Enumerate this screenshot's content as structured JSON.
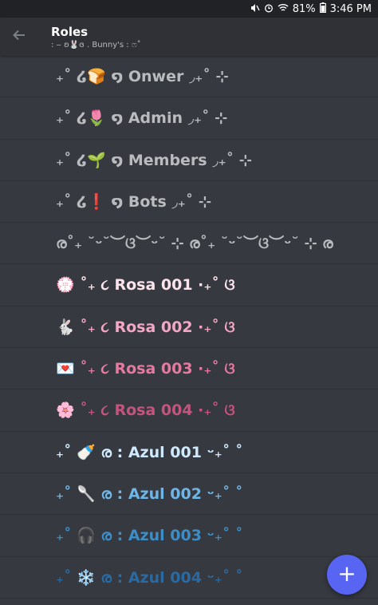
{
  "status_bar": {
    "mute_icon": "mute-icon",
    "alarm_icon": "alarm-icon",
    "wifi_icon": "wifi-icon",
    "battery_percent": "81%",
    "battery_icon": "battery-icon",
    "time": "3:46 PM"
  },
  "app_bar": {
    "back_icon": "arrow-left-icon",
    "title": "Roles",
    "subtitle": ": ‒ ʚ🐰ɞ . Bunny's : ෆ˚"
  },
  "roles": [
    {
      "name": "₊˚ ໒🍞 ໑ Onwer ◞₊˚ ⊹",
      "color": "#b9bbbe"
    },
    {
      "name": "₊˚ ໒🌷 ໑ Admin ◞₊˚ ⊹",
      "color": "#b9bbbe"
    },
    {
      "name": "₊˚ ໒🌱 ໑ Members ◞₊˚ ⊹",
      "color": "#b9bbbe"
    },
    {
      "name": "₊˚ ໒❗ ໑ Bots ◞₊˚ ⊹",
      "color": "#b9bbbe"
    },
    {
      "name": "ര˚₊ ˘ᵕ˘︶ଓ︶ᵕ˘ ⊹ ര˚₊ ˘ᵕ˘︶ଓ︶ᵕ˘ ⊹ ര",
      "color": "#b9bbbe"
    },
    {
      "name": "💮 ˚₊ ૮ Rosa 001 ·₊˚ ଓ",
      "color": "#fce4ec"
    },
    {
      "name": "🐇 ˚₊ ૮ Rosa 002 ·₊˚ ଓ",
      "color": "#f4a7c5"
    },
    {
      "name": "💌 ˚₊ ૮ Rosa 003 ·₊˚ ଓ",
      "color": "#e57aa0"
    },
    {
      "name": "🌸 ˚₊ ૮ Rosa 004 ·₊˚ ଓ",
      "color": "#c4547e"
    },
    {
      "name": "₊˚ 🍼 ര : Azul 001 ᵕ₊˚ ˚",
      "color": "#cfe9ff"
    },
    {
      "name": "₊˚ 🥄 ര : Azul 002 ᵕ₊˚ ˚",
      "color": "#6fb6e6"
    },
    {
      "name": "₊˚ 🎧 ര : Azul 003 ᵕ₊˚ ˚",
      "color": "#3d8dc7"
    },
    {
      "name": "₊˚ ❄️ ര : Azul 004 ᵕ₊˚ ˚",
      "color": "#2a6aa3"
    }
  ],
  "fab": {
    "icon": "plus-icon",
    "label": "+"
  }
}
